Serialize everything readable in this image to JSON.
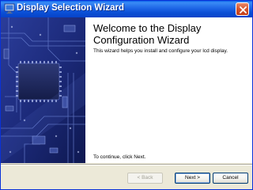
{
  "window": {
    "title": "Display Selection Wizard"
  },
  "content": {
    "title": "Welcome to the Display Configuration Wizard",
    "description": "This wizard helps you install and configure your lcd display.",
    "continue_hint": "To continue, click Next."
  },
  "buttons": {
    "back_label": "< Back",
    "next_label": "Next >",
    "cancel_label": "Cancel"
  },
  "icons": {
    "title_icon": "monitor-icon",
    "close": "close-icon",
    "side_art": "circuit-board-image"
  },
  "colors": {
    "titlebar": "#0A4FD6",
    "close_button": "#D4532C",
    "side_panel": "#1B2A77",
    "dialog_bg": "#ECE9D8"
  }
}
